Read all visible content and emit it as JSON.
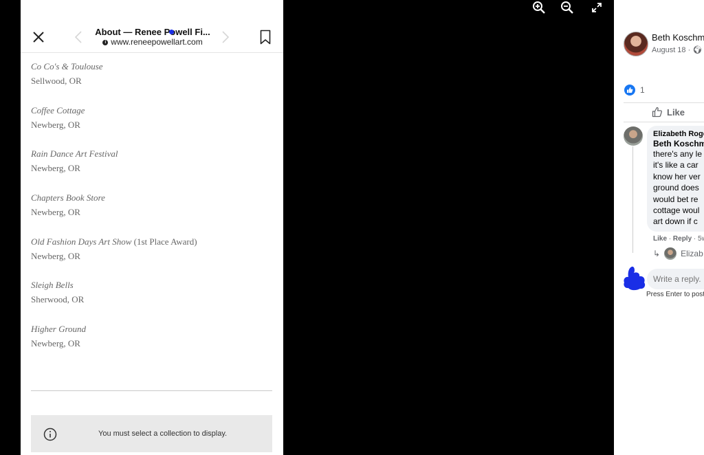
{
  "phone": {
    "title": "About — Renee Powell Fi...",
    "url": "www.reneepowellart.com",
    "venues": [
      {
        "name": "Co Co's & Toulouse",
        "award": "",
        "place": "Sellwood, OR"
      },
      {
        "name": "Coffee Cottage",
        "award": "",
        "place": "Newberg, OR"
      },
      {
        "name": "Rain Dance Art Festival",
        "award": "",
        "place": "Newberg, OR"
      },
      {
        "name": "Chapters Book Store",
        "award": "",
        "place": "Newberg, OR"
      },
      {
        "name": "Old Fashion Days Art Show",
        "award": " (1st Place Award)",
        "place": "Newberg, OR"
      },
      {
        "name": "Sleigh Bells",
        "award": "",
        "place": "Sherwood, OR"
      },
      {
        "name": "Higher Ground",
        "award": "",
        "place": "Newberg, OR"
      }
    ],
    "notice": "You must select a collection to display."
  },
  "viewer": {
    "icons": [
      "zoom-in-icon",
      "zoom-out-icon",
      "fullscreen-icon"
    ]
  },
  "fb": {
    "poster_name": "Beth Koschm",
    "post_date": "August 18 · ",
    "like_count": "1",
    "like_label": "Like",
    "comment": {
      "author": "Elizabeth Roge",
      "mention": "Beth Koschm",
      "text": "there's any le\nit's like a car\nknow her ver\nground does\nwould bet re\ncottage woul\nart down if c"
    },
    "comment_actions": {
      "like": "Like",
      "reply": "Reply",
      "age": "5w"
    },
    "reply_preview": "Elizab",
    "reply_placeholder": "Write a reply.",
    "press_enter": "Press Enter to post"
  },
  "colors": {
    "facebook_blue": "#1877f2",
    "annotation_blue": "#1a2ee6"
  }
}
